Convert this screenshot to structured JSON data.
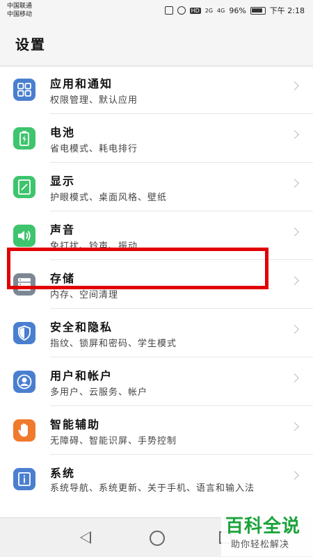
{
  "status_bar": {
    "carrier1": "中国联通",
    "carrier2": "中国移动",
    "battery": "96%",
    "time": "下午 2:18",
    "network1": "2G",
    "network2": "4G"
  },
  "header": {
    "title": "设置"
  },
  "settings": [
    {
      "title": "应用和通知",
      "subtitle": "权限管理、默认应用",
      "icon": "apps-grid-icon",
      "color": "#4a7fd0"
    },
    {
      "title": "电池",
      "subtitle": "省电模式、耗电排行",
      "icon": "battery-icon",
      "color": "#3ec46d"
    },
    {
      "title": "显示",
      "subtitle": "护眼模式、桌面风格、壁纸",
      "icon": "display-icon",
      "color": "#3ec46d"
    },
    {
      "title": "声音",
      "subtitle": "免打扰、铃声、振动",
      "icon": "speaker-icon",
      "color": "#3ec46d"
    },
    {
      "title": "存储",
      "subtitle": "内存、空间清理",
      "icon": "storage-icon",
      "color": "#7d8794"
    },
    {
      "title": "安全和隐私",
      "subtitle": "指纹、锁屏和密码、学生模式",
      "icon": "shield-icon",
      "color": "#4a7fd0"
    },
    {
      "title": "用户和帐户",
      "subtitle": "多用户、云服务、帐户",
      "icon": "user-icon",
      "color": "#4a7fd0"
    },
    {
      "title": "智能辅助",
      "subtitle": "无障碍、智能识屏、手势控制",
      "icon": "hand-icon",
      "color": "#f07a2c"
    },
    {
      "title": "系统",
      "subtitle": "系统导航、系统更新、关于手机、语言和输入法",
      "icon": "info-icon",
      "color": "#4a7fd0"
    }
  ],
  "watermark": {
    "big": "百科全说",
    "small": "助你轻松解决"
  }
}
